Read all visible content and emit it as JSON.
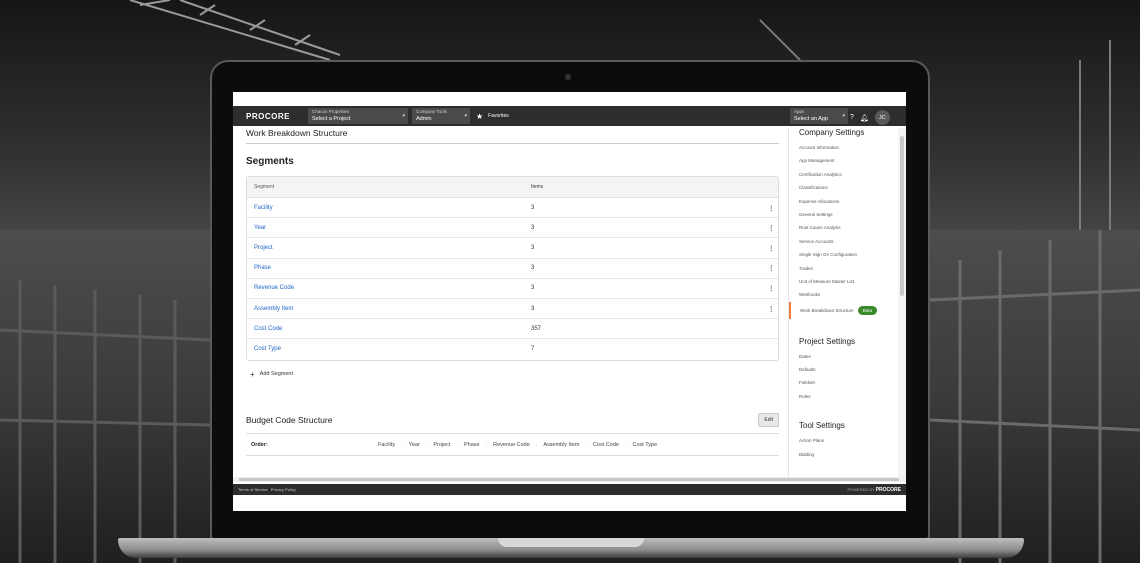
{
  "topbar": {
    "logo": "PROCORE",
    "project_picker": {
      "company": "Chacon Properties",
      "value": "Select a Project"
    },
    "tools_picker": {
      "label": "Company Tools",
      "value": "Admin"
    },
    "favorites": "Favorites",
    "apps_picker": {
      "label": "Apps",
      "value": "Select an App"
    },
    "avatar_initials": "JC"
  },
  "main": {
    "page_title": "Work Breakdown Structure",
    "segments_title": "Segments",
    "table": {
      "headers": [
        "Segment",
        "Items"
      ],
      "rows": [
        {
          "segment": "Facility",
          "items": "3"
        },
        {
          "segment": "Year",
          "items": "3"
        },
        {
          "segment": "Project",
          "items": "3"
        },
        {
          "segment": "Phase",
          "items": "3"
        },
        {
          "segment": "Revenue Code",
          "items": "3"
        },
        {
          "segment": "Assembly Item",
          "items": "3"
        },
        {
          "segment": "Cost Code",
          "items": "357"
        },
        {
          "segment": "Cost Type",
          "items": "7"
        }
      ]
    },
    "add_segment": "Add Segment",
    "budget": {
      "title": "Budget Code Structure",
      "edit_label": "Edit",
      "order_label": "Order:",
      "order": [
        "Facility",
        "Year",
        "Project",
        "Phase",
        "Revenue Code",
        "Assembly Item",
        "Cost Code",
        "Cost Type"
      ],
      "separator": "."
    }
  },
  "sidebar": {
    "company_settings_title": "Company Settings",
    "company_items": [
      "Account Information",
      "App Management",
      "Certification Analytics",
      "Classifications",
      "Expense Allocations",
      "General Settings",
      "Root Cause Analysis",
      "Service Accounts",
      "Single Sign On Configuration",
      "Trades",
      "Unit of Measure Master List",
      "Webhooks"
    ],
    "active_item": "Work Breakdown Structure",
    "beta_badge": "Beta",
    "project_settings_title": "Project Settings",
    "project_items": [
      "Dates",
      "Defaults",
      "Fieldset",
      "Roles"
    ],
    "tool_settings_title": "Tool Settings",
    "tool_items": [
      "Action Plans",
      "Bidding"
    ]
  },
  "footer": {
    "terms": "Terms of Service",
    "privacy": "Privacy Policy",
    "powered_by": "POWERED BY",
    "powered_logo": "PROCORE"
  },
  "colors": {
    "link": "#2066c6",
    "accent": "#f47e42",
    "beta": "#3a8a2a",
    "topbar": "#2d2d2d"
  }
}
